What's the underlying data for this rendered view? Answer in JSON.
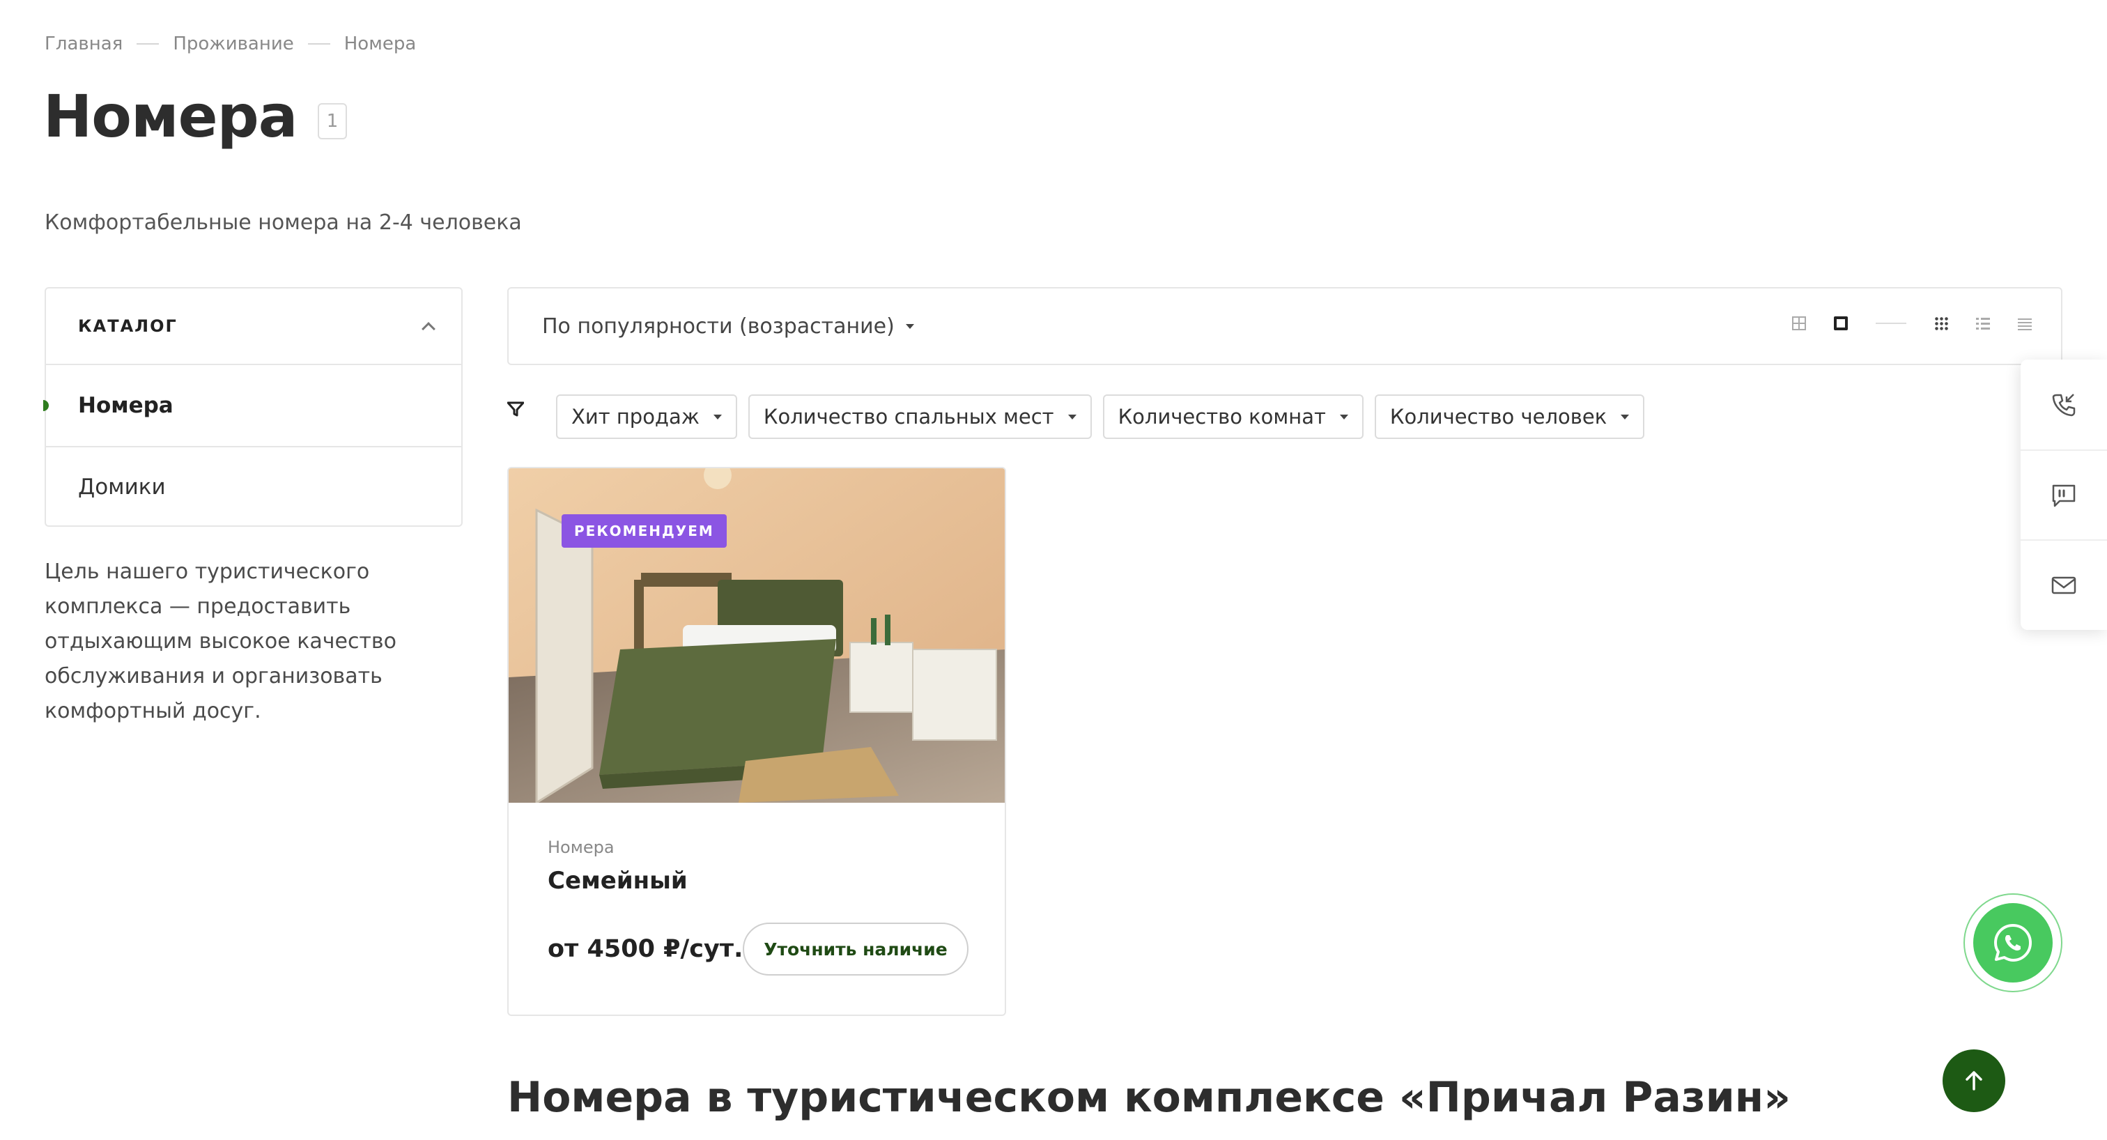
{
  "breadcrumb": [
    "Главная",
    "Проживание",
    "Номера"
  ],
  "page": {
    "title": "Номера",
    "count": "1",
    "subtitle": "Комфортабельные номера на 2-4 человека"
  },
  "catalog": {
    "title": "КАТАЛОГ",
    "items": [
      "Номера",
      "Домики"
    ],
    "active_index": 0,
    "description": "Цель нашего туристического комплекса — предоставить отдыхающим высокое качество обслуживания и организовать комфортный досуг."
  },
  "sort": {
    "selected": "По популярности (возрастание)",
    "view_icons": [
      "grid-small-icon",
      "grid-large-icon",
      "divider",
      "tiles-icon",
      "list-icon",
      "table-icon"
    ]
  },
  "filters": [
    "Хит продаж",
    "Количество спальных мест",
    "Количество комнат",
    "Количество человек"
  ],
  "product": {
    "badge": "РЕКОМЕНДУЕМ",
    "category": "Номера",
    "name": "Семейный",
    "price": "от 4500 ₽/сут.",
    "button": "Уточнить наличие"
  },
  "section_title": "Номера в туристическом комплексе «Причал Разин»",
  "colors": {
    "accent_green": "#1d5a14",
    "badge_purple": "#8b55e3",
    "whatsapp": "#48c95f"
  }
}
